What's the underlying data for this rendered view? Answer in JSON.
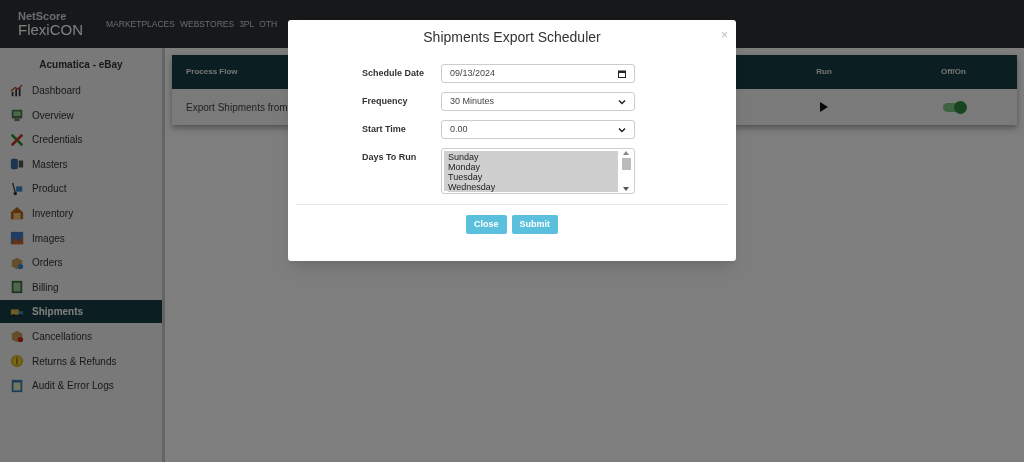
{
  "header": {
    "logo_top": "NetScore",
    "logo_bottom": "FlexiCON",
    "nav": [
      "MARKETPLACES",
      "WEBSTORES",
      "3PL",
      "OTH"
    ]
  },
  "sidebar": {
    "title": "Acumatica - eBay",
    "items": [
      {
        "label": "Dashboard",
        "selected": false
      },
      {
        "label": "Overview",
        "selected": false
      },
      {
        "label": "Credentials",
        "selected": false
      },
      {
        "label": "Masters",
        "selected": false
      },
      {
        "label": "Product",
        "selected": false
      },
      {
        "label": "Inventory",
        "selected": false
      },
      {
        "label": "Images",
        "selected": false
      },
      {
        "label": "Orders",
        "selected": false
      },
      {
        "label": "Billing",
        "selected": false
      },
      {
        "label": "Shipments",
        "selected": true
      },
      {
        "label": "Cancellations",
        "selected": false
      },
      {
        "label": "Returns & Refunds",
        "selected": false
      },
      {
        "label": "Audit & Error Logs",
        "selected": false
      }
    ]
  },
  "table": {
    "columns": [
      "Process Flow",
      "Run",
      "Off/On"
    ],
    "rows": [
      {
        "process": "Export Shipments from",
        "on": true
      }
    ]
  },
  "modal": {
    "title": "Shipments Export Scheduler",
    "close": "×",
    "fields": [
      {
        "kind": "date",
        "label": "Schedule Date",
        "value": "09/13/2024"
      },
      {
        "kind": "select",
        "label": "Frequency",
        "value": "30 Minutes"
      },
      {
        "kind": "select",
        "label": "Start Time",
        "value": "0.00"
      },
      {
        "kind": "list",
        "label": "Days To Run",
        "options": [
          {
            "label": "Sunday",
            "selected": true
          },
          {
            "label": "Monday",
            "selected": true
          },
          {
            "label": "Tuesday",
            "selected": true
          },
          {
            "label": "Wednesday",
            "selected": true
          }
        ]
      }
    ],
    "buttons": [
      "Close",
      "Submit"
    ]
  }
}
